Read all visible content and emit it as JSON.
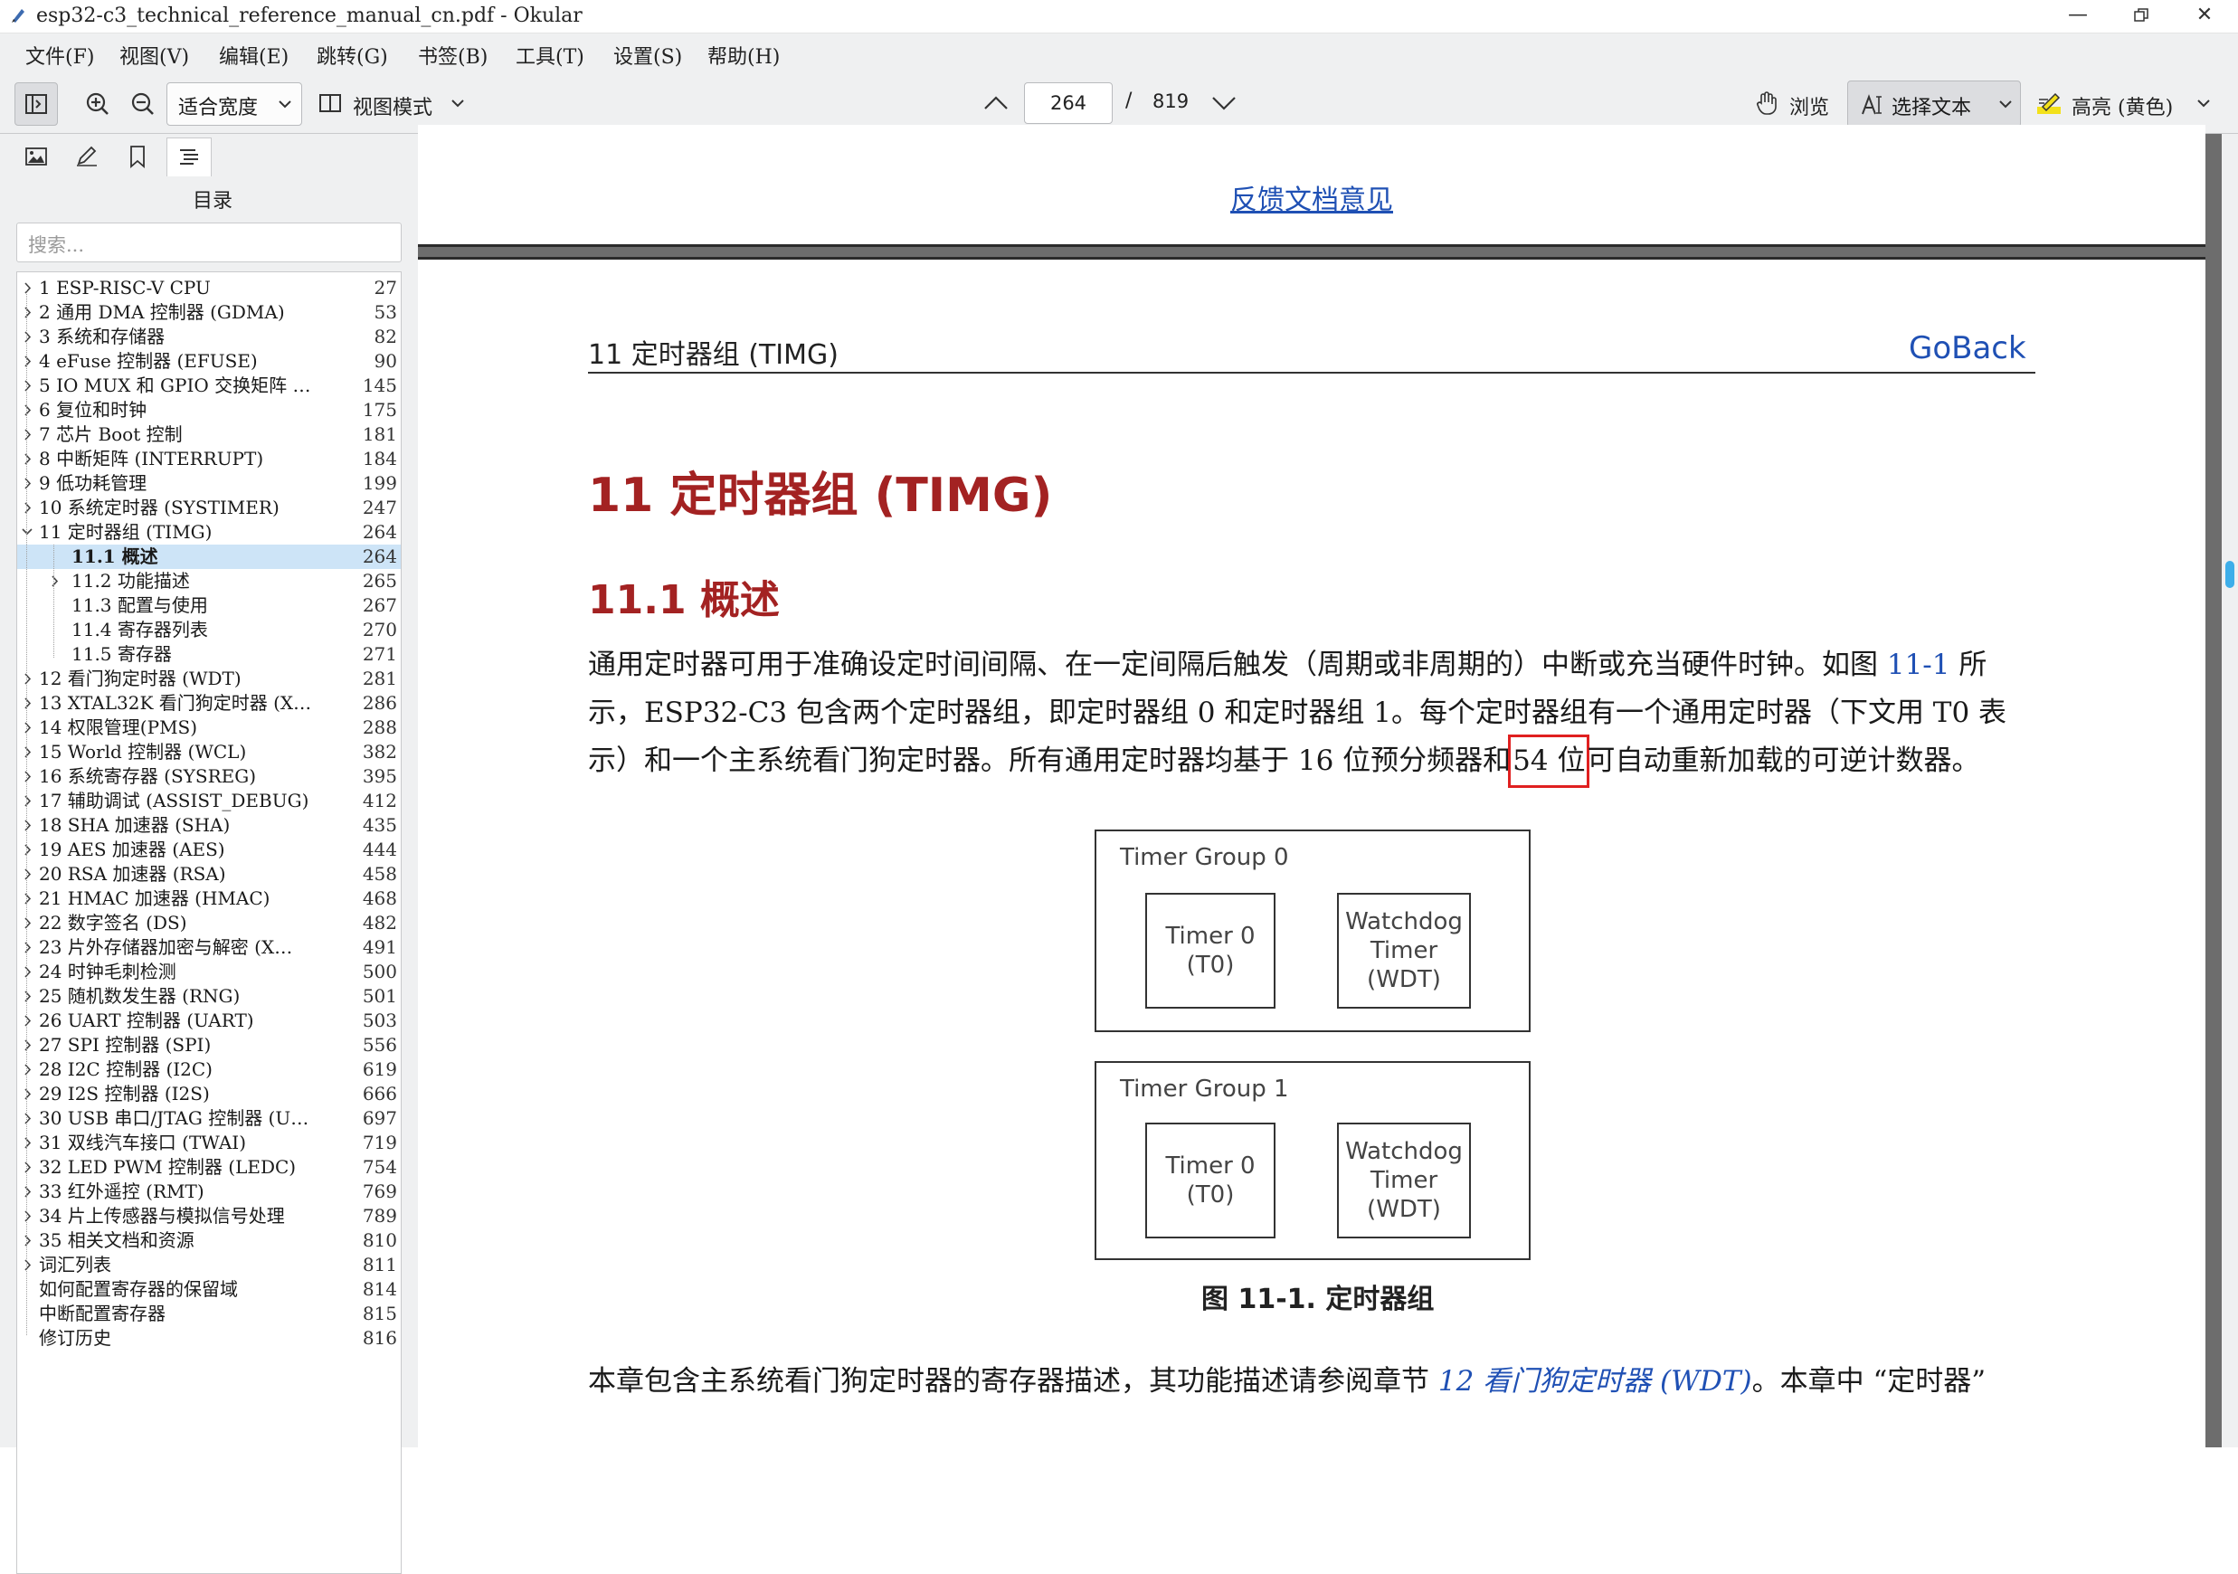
{
  "window": {
    "title": "esp32-c3_technical_reference_manual_cn.pdf  - Okular"
  },
  "menu": [
    "文件(F)",
    "视图(V)",
    "编辑(E)",
    "跳转(G)",
    "书签(B)",
    "工具(T)",
    "设置(S)",
    "帮助(H)"
  ],
  "toolbar": {
    "zoom_value": "适合宽度",
    "view_mode_label": "视图模式",
    "page_current": "264",
    "page_sep": "/",
    "page_total": "819",
    "browse_label": "浏览",
    "select_text_label": "选择文本",
    "highlight_label": "高亮 (黄色)"
  },
  "sidebar": {
    "title": "目录",
    "search_placeholder": "搜索...",
    "toc": [
      {
        "label": "1 ESP-RISC-V CPU",
        "page": "27"
      },
      {
        "label": "2 通用 DMA 控制器 (GDMA)",
        "page": "53"
      },
      {
        "label": "3 系统和存储器",
        "page": "82"
      },
      {
        "label": "4 eFuse 控制器 (EFUSE)",
        "page": "90"
      },
      {
        "label": "5 IO MUX 和 GPIO 交换矩阵 …",
        "page": "145"
      },
      {
        "label": "6 复位和时钟",
        "page": "175"
      },
      {
        "label": "7 芯片 Boot 控制",
        "page": "181"
      },
      {
        "label": "8 中断矩阵 (INTERRUPT)",
        "page": "184"
      },
      {
        "label": "9 低功耗管理",
        "page": "199"
      },
      {
        "label": "10 系统定时器 (SYSTIMER)",
        "page": "247"
      },
      {
        "label": "11 定时器组 (TIMG)",
        "page": "264"
      },
      {
        "label": "11.1 概述",
        "page": "264"
      },
      {
        "label": "11.2 功能描述",
        "page": "265"
      },
      {
        "label": "11.3 配置与使用",
        "page": "267"
      },
      {
        "label": "11.4 寄存器列表",
        "page": "270"
      },
      {
        "label": "11.5 寄存器",
        "page": "271"
      },
      {
        "label": "12 看门狗定时器 (WDT)",
        "page": "281"
      },
      {
        "label": "13 XTAL32K 看门狗定时器 (X…",
        "page": "286"
      },
      {
        "label": "14 权限管理(PMS)",
        "page": "288"
      },
      {
        "label": "15 World 控制器 (WCL)",
        "page": "382"
      },
      {
        "label": "16 系统寄存器 (SYSREG)",
        "page": "395"
      },
      {
        "label": "17 辅助调试 (ASSIST_DEBUG)",
        "page": "412"
      },
      {
        "label": "18 SHA 加速器 (SHA)",
        "page": "435"
      },
      {
        "label": "19 AES 加速器 (AES)",
        "page": "444"
      },
      {
        "label": "20 RSA 加速器 (RSA)",
        "page": "458"
      },
      {
        "label": "21 HMAC 加速器 (HMAC)",
        "page": "468"
      },
      {
        "label": "22 数字签名 (DS)",
        "page": "482"
      },
      {
        "label": "23 片外存储器加密与解密 (X…",
        "page": "491"
      },
      {
        "label": "24 时钟毛刺检测",
        "page": "500"
      },
      {
        "label": "25 随机数发生器 (RNG)",
        "page": "501"
      },
      {
        "label": "26 UART 控制器 (UART)",
        "page": "503"
      },
      {
        "label": "27 SPI 控制器 (SPI)",
        "page": "556"
      },
      {
        "label": "28 I2C 控制器 (I2C)",
        "page": "619"
      },
      {
        "label": "29 I2S 控制器 (I2S)",
        "page": "666"
      },
      {
        "label": "30 USB 串口/JTAG 控制器 (U…",
        "page": "697"
      },
      {
        "label": "31 双线汽车接口 (TWAI)",
        "page": "719"
      },
      {
        "label": "32 LED PWM 控制器 (LEDC)",
        "page": "754"
      },
      {
        "label": "33 红外遥控 (RMT)",
        "page": "769"
      },
      {
        "label": "34 片上传感器与模拟信号处理",
        "page": "789"
      },
      {
        "label": "35 相关文档和资源",
        "page": "810"
      },
      {
        "label": "词汇列表",
        "page": "811"
      },
      {
        "label": "如何配置寄存器的保留域",
        "page": "814"
      },
      {
        "label": "中断配置寄存器",
        "page": "815"
      },
      {
        "label": "修订历史",
        "page": "816"
      }
    ]
  },
  "document": {
    "prev_page_link": "反馈文档意见",
    "header_left": "11    定时器组 (TIMG)",
    "header_right": "GoBack",
    "h1": "11    定时器组 (TIMG)",
    "h2": "11.1    概述",
    "para1_a": "通用定时器可用于准确设定时间间隔、在一定间隔后触发（周期或非周期的）中断或充当硬件时钟。如图 ",
    "para1_ref": "11-1",
    "para1_b": " 所示，ESP32-C3 包含两个定时器组，即定时器组 0 和定时器组 1。每个定时器组有一个通用定时器（下文用 T0 表示）和一个主系统看门狗定时器。所有通用定时器均基于 16 位预分频器和",
    "para1_hl": "54 位",
    "para1_c": "可自动重新加载的可逆计数器。",
    "figure": {
      "group0": "Timer Group 0",
      "group1": "Timer Group 1",
      "timer": "Timer 0\n(T0)",
      "wdt": "Watchdog\nTimer\n(WDT)",
      "caption": "图 11-1. 定时器组"
    },
    "para2_a": "本章包含主系统看门狗定时器的寄存器描述，其功能描述请参阅章节 ",
    "para2_ref": "12 看门狗定时器 (WDT)",
    "para2_b": "。本章中 “定时器”"
  }
}
